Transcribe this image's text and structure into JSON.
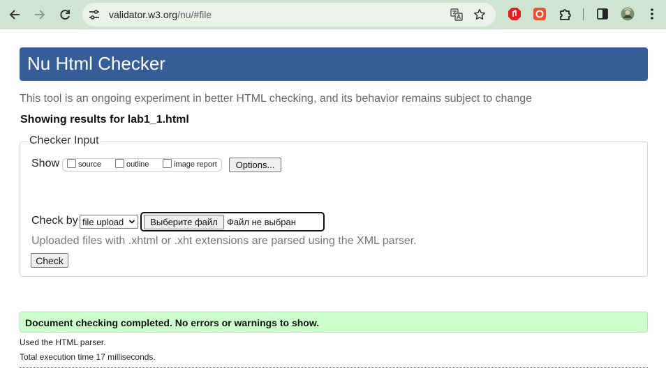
{
  "browser": {
    "url_host": "validator.w3.org",
    "url_path": "/nu/#file",
    "icons": [
      "back-arrow-icon",
      "forward-arrow-icon",
      "reload-icon",
      "site-info-icon",
      "translate-icon",
      "bookmark-star-icon",
      "extension-red-icon",
      "extension-orange-icon",
      "puzzle-extensions-icon",
      "side-panel-icon",
      "profile-avatar",
      "kebab-menu-icon"
    ]
  },
  "page": {
    "title": "Nu Html Checker",
    "tagline": "This tool is an ongoing experiment in better HTML checking, and its behavior remains subject to change",
    "results_for": "Showing results for lab1_1.html"
  },
  "checker_input": {
    "legend": "Checker Input",
    "show_label": "Show",
    "show_options": [
      {
        "label": "source",
        "checked": false
      },
      {
        "label": "outline",
        "checked": false
      },
      {
        "label": "image report",
        "checked": false
      }
    ],
    "options_button": "Options...",
    "check_by_label": "Check by",
    "check_by_value": "file upload",
    "file_button": "Выберите файл",
    "file_status": "Файл не выбран",
    "hint": "Uploaded files with .xhtml or .xht extensions are parsed using the XML parser.",
    "check_button": "Check"
  },
  "results": {
    "success_message": "Document checking completed. No errors or warnings to show.",
    "parser_note": "Used the HTML parser.",
    "time_note": "Total execution time 17 milliseconds."
  },
  "colors": {
    "chrome_bg": "#cfe5d2",
    "banner_bg": "#365d95",
    "success_bg": "#ccffcc"
  }
}
